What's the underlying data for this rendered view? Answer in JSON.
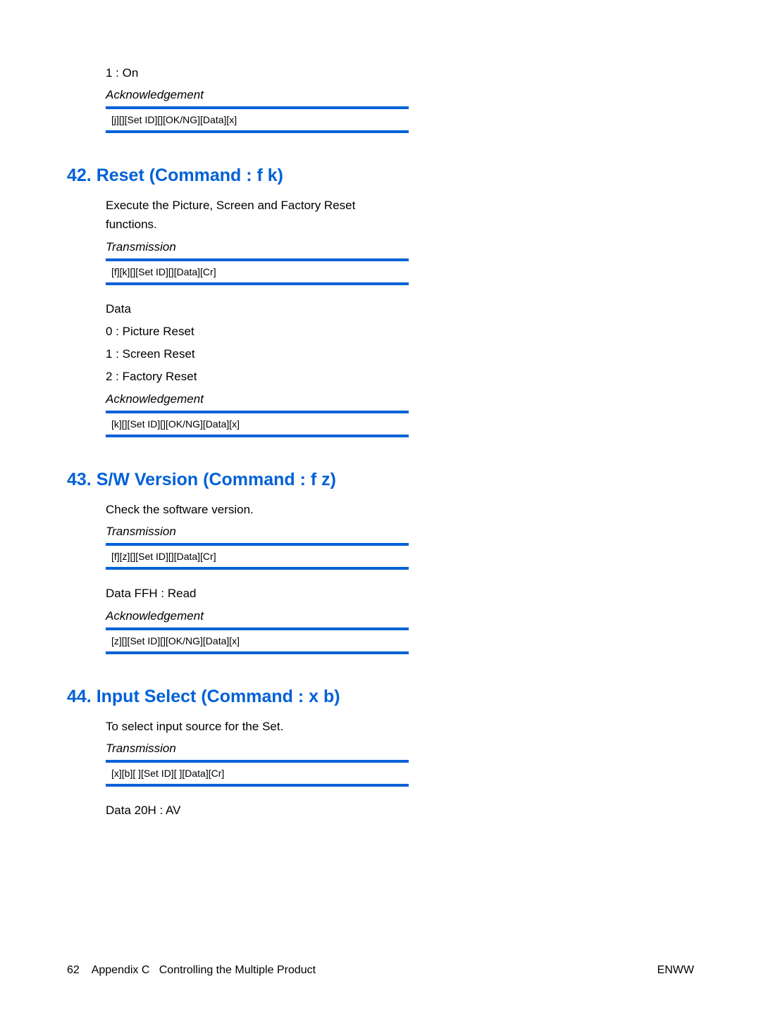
{
  "top": {
    "onLine": "1 : On",
    "ackLabel": "Acknowledgement",
    "ackCode": "[j][][Set ID][][OK/NG][Data][x]"
  },
  "s42": {
    "heading": "42. Reset (Command : f k)",
    "desc": "Execute the Picture, Screen and Factory Reset functions.",
    "transLabel": "Transmission",
    "transCode": "[f][k][][Set ID][][Data][Cr]",
    "dataLabel": "Data",
    "d0": "0 : Picture Reset",
    "d1": "1 : Screen Reset",
    "d2": "2 : Factory Reset",
    "ackLabel": "Acknowledgement",
    "ackCode": "[k][][Set ID][][OK/NG][Data][x]"
  },
  "s43": {
    "heading": "43. S/W Version (Command : f z)",
    "desc": "Check the software version.",
    "transLabel": "Transmission",
    "transCode": "[f][z][][Set ID][][Data][Cr]",
    "dataLine": "Data FFH : Read",
    "ackLabel": "Acknowledgement",
    "ackCode": "[z][][Set ID][][OK/NG][Data][x]"
  },
  "s44": {
    "heading": "44. Input Select (Command : x b)",
    "desc": "To select input source for the Set.",
    "transLabel": "Transmission",
    "transCode": "[x][b][ ][Set ID][ ][Data][Cr]",
    "dataLine": "Data 20H : AV"
  },
  "footer": {
    "left": "62    Appendix C   Controlling the Multiple Product",
    "right": "ENWW"
  }
}
